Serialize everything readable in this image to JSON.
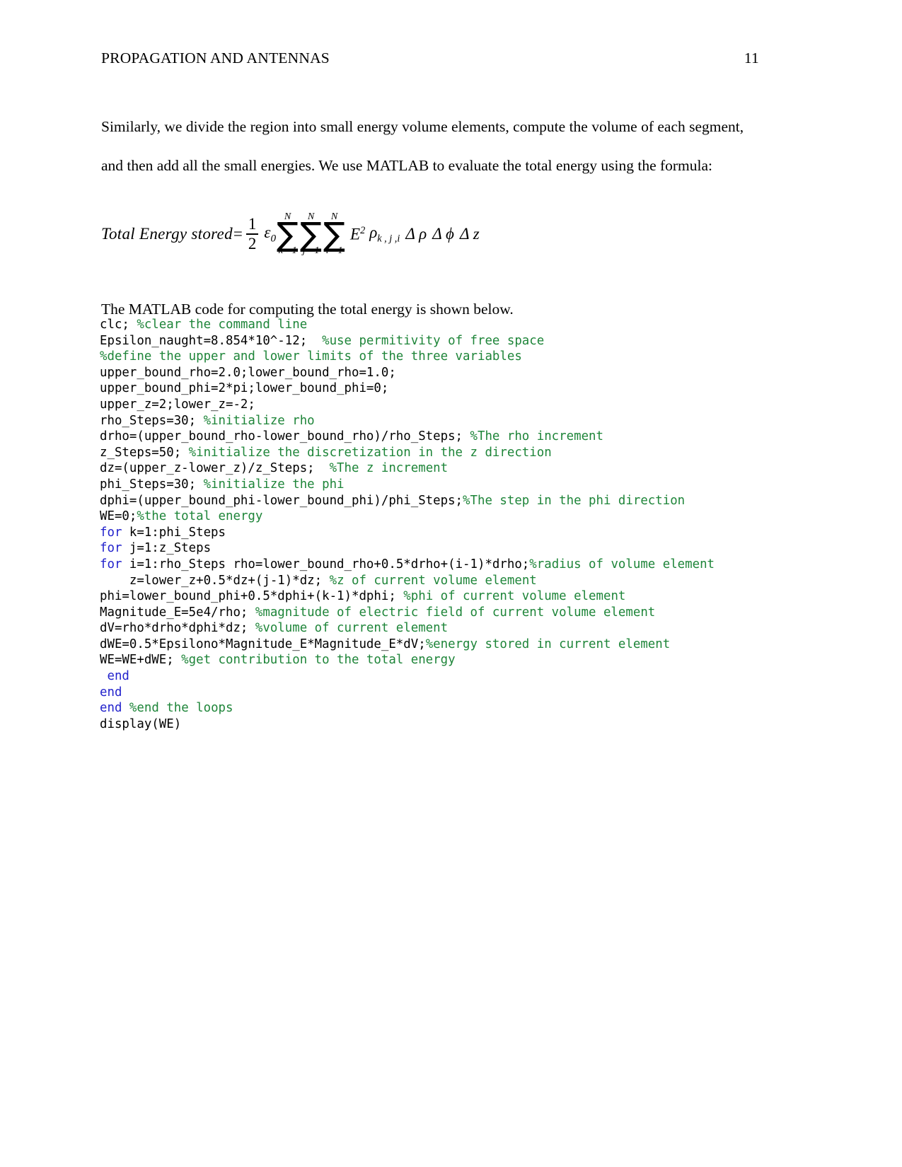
{
  "header": {
    "title": "PROPAGATION AND ANTENNAS",
    "page_number": "11"
  },
  "body": {
    "paragraph_1": "Similarly, we divide the region into small energy volume elements, compute the volume of each segment, and then add all the small energies. We use MATLAB to evaluate the total energy using the formula:",
    "paragraph_2": "The MATLAB code for computing the total energy is shown below."
  },
  "formula": {
    "lhs": "Total Energy stored",
    "equals": "=",
    "fraction_numerator": "1",
    "fraction_denominator": "2",
    "epsilon": "ε",
    "epsilon_subscript": "0",
    "sum_symbol": "∑",
    "sum_1_upper": "N",
    "sum_1_lower": "k =1",
    "sum_2_upper": "N",
    "sum_2_lower": "j =1",
    "sum_3_upper": "N",
    "sum_3_lower": "i =1",
    "field_symbol": "E",
    "field_exponent": "2",
    "rho_symbol": "ρ",
    "rho_subscript": "k , j ,i",
    "d_rho": "Δ ρ",
    "d_phi": "Δ ϕ",
    "d_z": "Δ z",
    "plain_text": "Total Energy stored = (1/2) ε0 ∑(k=1..N) ∑(j=1..N) ∑(i=1..N) E² ρk,j,i Δρ Δϕ Δz"
  },
  "code": {
    "language": "MATLAB",
    "colors": {
      "comment": "#1e8539",
      "keyword": "#2222cc",
      "code": "#000000"
    },
    "lines": [
      [
        {
          "t": "clc; ",
          "c": "cd"
        },
        {
          "t": "%clear the command line",
          "c": "cm"
        }
      ],
      [
        {
          "t": "Epsilon_naught=8.854*10^-12;  ",
          "c": "cd"
        },
        {
          "t": "%use permitivity of free space",
          "c": "cm"
        }
      ],
      [
        {
          "t": "%define the upper and lower limits of the three variables",
          "c": "cm"
        }
      ],
      [
        {
          "t": "upper_bound_rho=2.0;lower_bound_rho=1.0;",
          "c": "cd"
        }
      ],
      [
        {
          "t": "upper_bound_phi=2*pi;lower_bound_phi=0;",
          "c": "cd"
        }
      ],
      [
        {
          "t": "upper_z=2;lower_z=-2;",
          "c": "cd"
        }
      ],
      [
        {
          "t": "rho_Steps=30; ",
          "c": "cd"
        },
        {
          "t": "%initialize rho",
          "c": "cm"
        }
      ],
      [
        {
          "t": "drho=(upper_bound_rho-lower_bound_rho)/rho_Steps; ",
          "c": "cd"
        },
        {
          "t": "%The rho increment",
          "c": "cm"
        }
      ],
      [
        {
          "t": "z_Steps=50; ",
          "c": "cd"
        },
        {
          "t": "%initialize the discretization in the z direction",
          "c": "cm"
        }
      ],
      [
        {
          "t": "dz=(upper_z-lower_z)/z_Steps;  ",
          "c": "cd"
        },
        {
          "t": "%The z increment",
          "c": "cm"
        }
      ],
      [
        {
          "t": "phi_Steps=30; ",
          "c": "cd"
        },
        {
          "t": "%initialize the phi",
          "c": "cm"
        }
      ],
      [
        {
          "t": "dphi=(upper_bound_phi-lower_bound_phi)/phi_Steps;",
          "c": "cd"
        },
        {
          "t": "%The step in the phi direction",
          "c": "cm"
        }
      ],
      [
        {
          "t": "WE=0;",
          "c": "cd"
        },
        {
          "t": "%the total energy",
          "c": "cm"
        }
      ],
      [
        {
          "t": "for",
          "c": "kw"
        },
        {
          "t": " k=1:phi_Steps",
          "c": "cd"
        }
      ],
      [
        {
          "t": "for",
          "c": "kw"
        },
        {
          "t": " j=1:z_Steps",
          "c": "cd"
        }
      ],
      [
        {
          "t": "for",
          "c": "kw"
        },
        {
          "t": " i=1:rho_Steps rho=lower_bound_rho+0.5*drho+(i-1)*drho;",
          "c": "cd"
        },
        {
          "t": "%radius of volume element",
          "c": "cm"
        }
      ],
      [
        {
          "t": "    z=lower_z+0.5*dz+(j-1)*dz; ",
          "c": "cd"
        },
        {
          "t": "%z of current volume element",
          "c": "cm"
        }
      ],
      [
        {
          "t": "phi=lower_bound_phi+0.5*dphi+(k-1)*dphi; ",
          "c": "cd"
        },
        {
          "t": "%phi of current volume element",
          "c": "cm"
        }
      ],
      [
        {
          "t": "Magnitude_E=5e4/rho; ",
          "c": "cd"
        },
        {
          "t": "%magnitude of electric field of current volume element",
          "c": "cm"
        }
      ],
      [
        {
          "t": "dV=rho*drho*dphi*dz; ",
          "c": "cd"
        },
        {
          "t": "%volume of current element",
          "c": "cm"
        }
      ],
      [
        {
          "t": "dWE=0.5*Epsilono*Magnitude_E*Magnitude_E*dV;",
          "c": "cd"
        },
        {
          "t": "%energy stored in current element",
          "c": "cm"
        }
      ],
      [
        {
          "t": "WE=WE+dWE; ",
          "c": "cd"
        },
        {
          "t": "%get contribution to the total energy",
          "c": "cm"
        }
      ],
      [
        {
          "t": " ",
          "c": "cd"
        },
        {
          "t": "end",
          "c": "kw"
        }
      ],
      [
        {
          "t": "end",
          "c": "kw"
        }
      ],
      [
        {
          "t": "end",
          "c": "kw"
        },
        {
          "t": " ",
          "c": "cd"
        },
        {
          "t": "%end the loops",
          "c": "cm"
        }
      ],
      [
        {
          "t": "display(WE)",
          "c": "cd"
        }
      ]
    ]
  }
}
